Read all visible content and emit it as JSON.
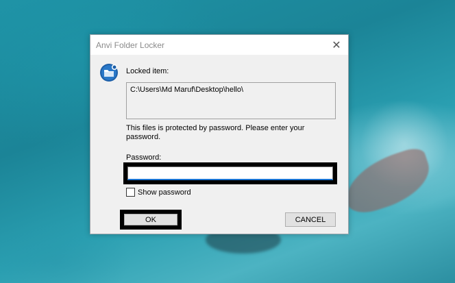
{
  "dialog": {
    "title": "Anvi Folder Locker",
    "locked_item_label": "Locked item:",
    "locked_item_path": "C:\\Users\\Md Maruf\\Desktop\\hello\\",
    "message": "This files is protected by password. Please enter your password.",
    "password_label": "Password:",
    "password_value": "",
    "show_password_label": "Show password",
    "show_password_checked": false,
    "ok_label": "OK",
    "cancel_label": "CANCEL",
    "close_glyph": "✕"
  },
  "icons": {
    "app": "folder-lock-icon",
    "close": "close-icon"
  },
  "colors": {
    "accent_input_underline": "#1a74d4",
    "dialog_bg": "#f0f0f0",
    "highlight_outline": "#000000"
  }
}
